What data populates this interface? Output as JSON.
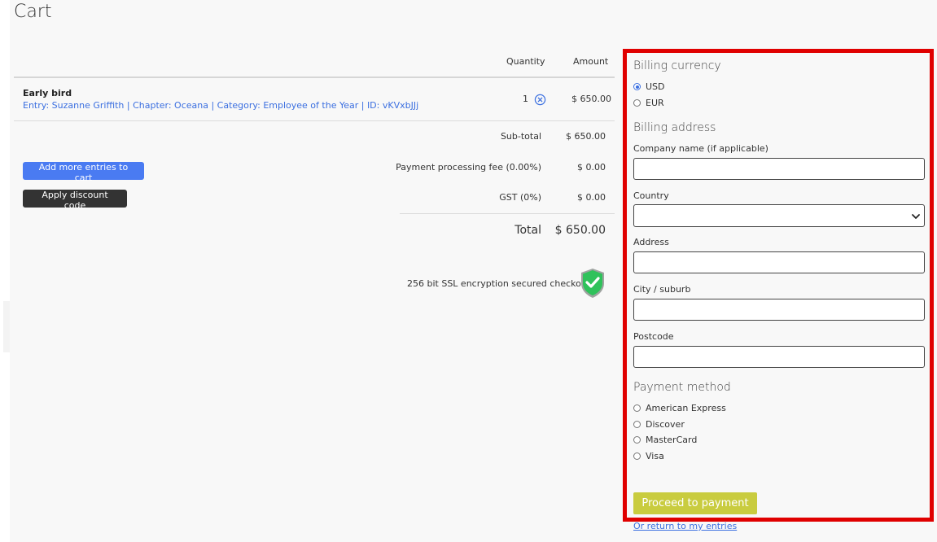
{
  "page": {
    "title": "Cart"
  },
  "cart": {
    "columns": {
      "quantity": "Quantity",
      "amount": "Amount"
    },
    "item": {
      "name": "Early bird",
      "description": "Entry: Suzanne Griffith | Chapter: Oceana | Category: Employee of the Year | ID: vKVxbJJj",
      "quantity": "1",
      "amount": "$ 650.00"
    },
    "summary": {
      "subtotal_label": "Sub-total",
      "subtotal_value": "$ 650.00",
      "fee_label": "Payment processing fee (0.00%)",
      "fee_value": "$ 0.00",
      "gst_label": "GST (0%)",
      "gst_value": "$ 0.00",
      "total_label": "Total",
      "total_value": "$ 650.00"
    },
    "buttons": {
      "add_more": "Add more entries to cart",
      "discount": "Apply discount code"
    },
    "ssl_text": "256 bit SSL encryption secured checkout"
  },
  "billing": {
    "currency_title": "Billing currency",
    "currencies": [
      {
        "label": "USD",
        "selected": true
      },
      {
        "label": "EUR",
        "selected": false
      }
    ],
    "address_title": "Billing address",
    "fields": {
      "company_label": "Company name (if applicable)",
      "country_label": "Country",
      "country_value": "",
      "address_label": "Address",
      "city_label": "City / suburb",
      "postcode_label": "Postcode"
    },
    "payment_title": "Payment method",
    "payment_methods": [
      "American Express",
      "Discover",
      "MasterCard",
      "Visa"
    ],
    "proceed_label": "Proceed to payment",
    "return_label": "Or return to my entries"
  },
  "colors": {
    "accent": "#4a7bf2",
    "proceed": "#c9cc3f",
    "highlight_border": "#e00000",
    "link": "#3b6fe0"
  }
}
